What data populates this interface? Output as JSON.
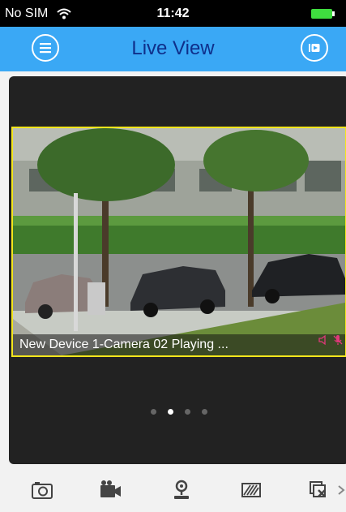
{
  "status_bar": {
    "carrier": "No SIM",
    "time": "11:42"
  },
  "header": {
    "title": "Live View",
    "menu_icon": "menu-icon",
    "playback_icon": "playback-icon"
  },
  "viewer": {
    "caption": "New Device 1-Camera 02  Playing ...",
    "page_count": 4,
    "current_page": 2
  },
  "toolbar": {
    "items": [
      "snapshot-icon",
      "record-icon",
      "ptz-icon",
      "image-quality-icon",
      "close-all-icon",
      "more-icon"
    ]
  },
  "colors": {
    "nav_bar": "#3aa8f5",
    "title": "#0f2f8a",
    "selection_border": "#f4e61c",
    "battery": "#3fdc3f"
  }
}
